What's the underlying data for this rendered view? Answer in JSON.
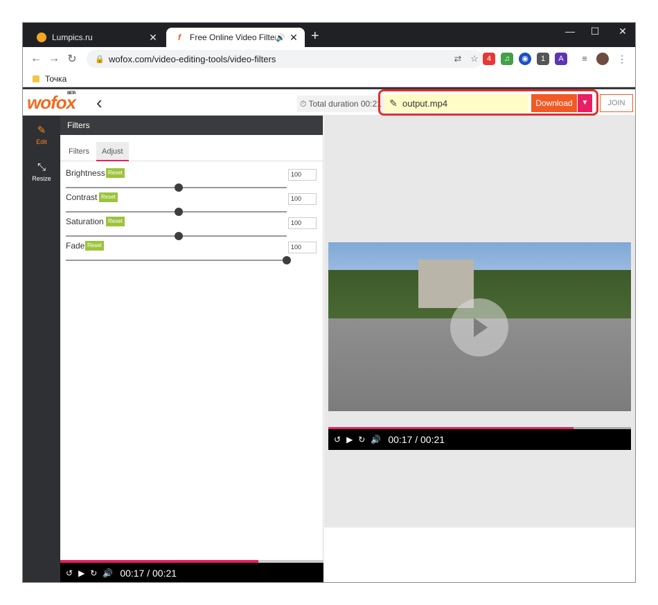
{
  "browser": {
    "tabs": [
      {
        "title": "Lumpics.ru",
        "active": false
      },
      {
        "title": "Free Online Video Filters | Wo",
        "active": true
      }
    ],
    "new_tab": "+",
    "window_controls": [
      "—",
      "☐",
      "✕"
    ],
    "url": "wofox.com/video-editing-tools/video-filters",
    "bookmarks": [
      {
        "label": "Точка"
      }
    ],
    "extension_badges": [
      "4",
      "1"
    ]
  },
  "app": {
    "logo": "wofox",
    "logo_badge": "BETA",
    "back_icon": "‹",
    "duration_label": "Total duration 00:21",
    "filename": "output.mp4",
    "download_label": "Download",
    "join_label": "JOIN",
    "rail": [
      {
        "label": "Edit",
        "icon": "edit-icon",
        "active": true
      },
      {
        "label": "Resize",
        "icon": "resize-icon",
        "active": false
      }
    ],
    "panel_title": "Filters",
    "subtabs": [
      "Filters",
      "Adjust"
    ],
    "active_subtab": "Adjust",
    "adjustments": [
      {
        "label": "Brightness",
        "reset": "Reset",
        "value": "100",
        "slider_fraction": 0.5
      },
      {
        "label": "Contrast",
        "reset": "Reset",
        "value": "100",
        "slider_fraction": 0.5
      },
      {
        "label": "Saturation",
        "reset": "Reset",
        "value": "100",
        "slider_fraction": 0.5
      },
      {
        "label": "Fade",
        "reset": "Reset",
        "value": "100",
        "slider_fraction": 1.0
      }
    ],
    "player_time": "00:17 / 00:21",
    "progress_fraction": 0.81,
    "colors": {
      "accent": "#f15a24",
      "pink": "#e91e63",
      "reset": "#9cc33b",
      "highlight": "#e52d27"
    }
  }
}
